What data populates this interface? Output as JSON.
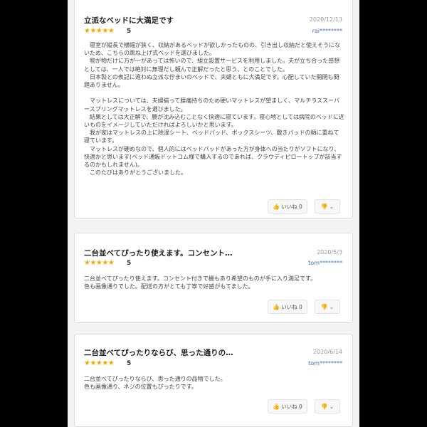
{
  "reviews": [
    {
      "title": "立派なベッドに大満足です",
      "date": "2020/12/13",
      "stars": "★★★★★",
      "rating": "5",
      "user": "rai********",
      "paragraphs": [
        "　寝室が縦長で横幅が狭く、収納があるベッドが欲しかったものの、引き出し収納だと使えそうにないため、こちらの跳ね上げ式ベッドを選びました。",
        "　物が物だけに万が一があっては怖いので、組立設置サービスを利用しました。夫が立ち合った感想としては、一人では絶対に無理だし頼んで正解だったと思う、とのことでした。",
        "　日本製との表記に違わぬ立派な佇まいのベッドで、夫婦ともに大満足です。心配していた開閉も問題ありません。",
        "",
        "　マットレスについては、夫婦揃って腰痛持ちのため硬いマットレスが望ましく、マルチラススーパースプリングマットレスを選びました。",
        "　結果としては大正解で、腰が沈み込むことなく快適に寝ています。寝心地としては病院のベッドに近いものをイメージしていただければよろしいかと思います。",
        "　我が家はマットレスの上に除湿シート、ベッドパッド、ボックスシーツ、敷きパッドの順に重ねて寝ています。",
        "　マットレスが硬めなので、個人的にはベッドパッドがあった方が身体への当たりがソフトになり、快適かと思います(ベッド通販ドットコム様で購入するのであれば、クラウディピロートップが該当するのかもしれません)。",
        "　このたびはありがとうございました。"
      ],
      "like_label": "いいね 0"
    },
    {
      "title": "二台並べてぴったり使えます。コンセント…",
      "date": "2020/5/3",
      "stars": "★★★★★",
      "rating": "5",
      "user": "tom********",
      "paragraphs": [
        "二台並べてぴったり使えます。コンセント付きで棚もあり希望のものが手に入り満足です。",
        "色も画像通りでした。配送の方がとても丁寧で好感がもてました。"
      ],
      "like_label": "いいね 0"
    },
    {
      "title": "二台並べてぴったりならび、思った通りの…",
      "date": "2020/6/14",
      "stars": "★★★★★",
      "rating": "5",
      "user": "tom********",
      "paragraphs": [
        "二台並べてぴったりならび、思った通りの品物でした。",
        "色も画像通り、ネジの位置もぴったりです。"
      ],
      "like_label": "いいね 0"
    }
  ],
  "icons": {
    "like": "thumbs-up-icon",
    "dislike": "thumbs-down-icon",
    "chevron": "chevron-down-icon"
  },
  "colors": {
    "star": "#f3a800",
    "user_link": "#3f6fb5",
    "background": "#000000"
  }
}
